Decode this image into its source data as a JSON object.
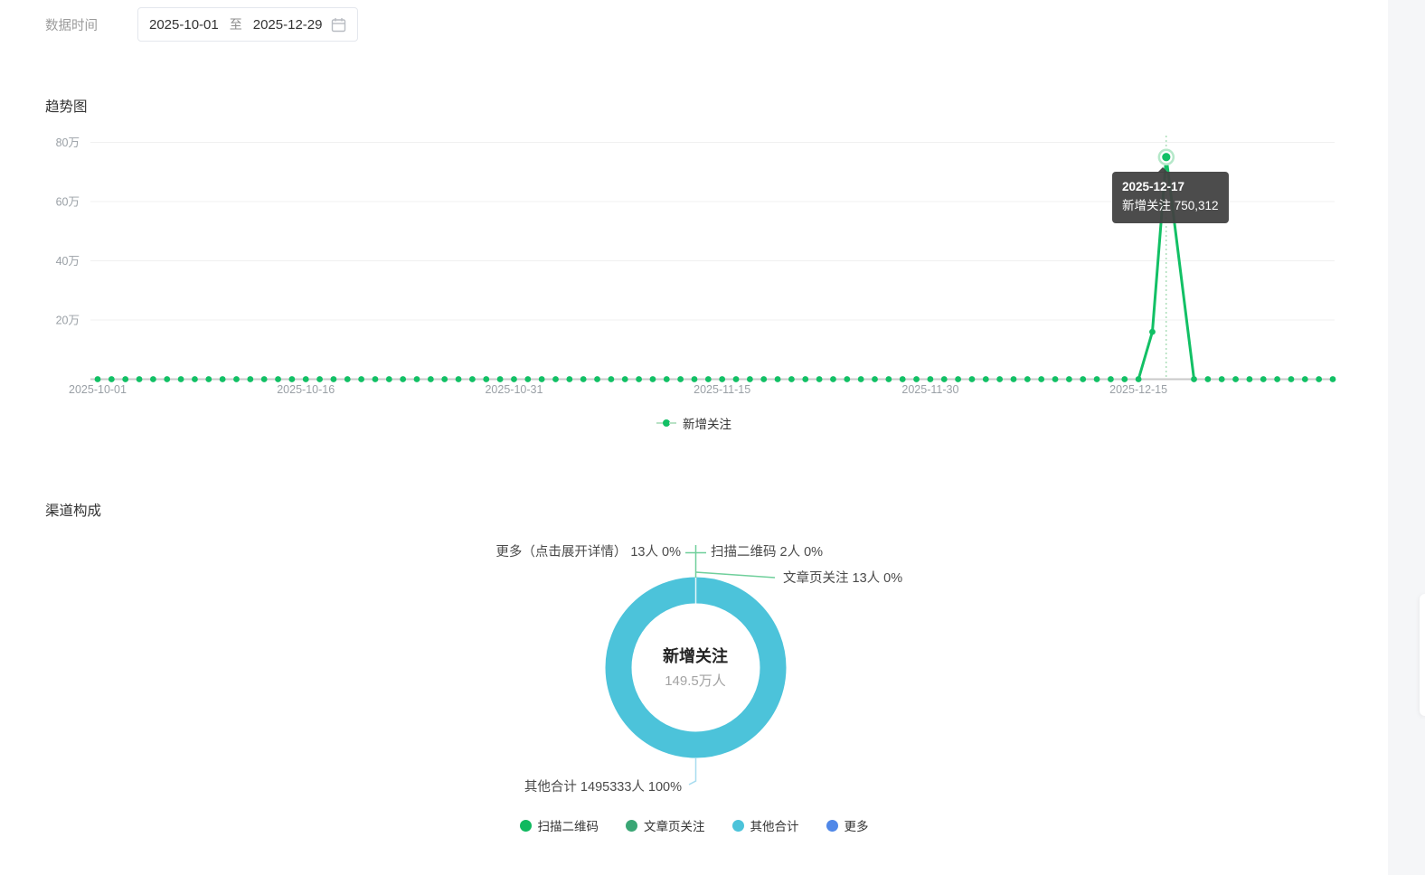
{
  "filter": {
    "label": "数据时间",
    "start_date": "2025-10-01",
    "separator": "至",
    "end_date": "2025-12-29"
  },
  "trend": {
    "title": "趋势图",
    "legend_label": "新增关注",
    "tooltip": {
      "date": "2025-12-17",
      "text": "新增关注 750,312"
    }
  },
  "channel": {
    "title": "渠道构成",
    "center_title": "新增关注",
    "center_value": "149.5万人",
    "callouts": {
      "more": "更多（点击展开详情） 13人 0%",
      "qr": "扫描二维码 2人 0%",
      "article": "文章页关注 13人 0%",
      "other": "其他合计 1495333人 100%"
    }
  },
  "colors": {
    "trend_line": "#12c065",
    "highlight_ring": "#b5e8c9",
    "pointer_line": "#86cf9a",
    "axis_line": "#c9c9c9",
    "grid_line": "#f0f0f0",
    "axis_text": "#9aa0a6",
    "donut_ring": "#4cc3da",
    "leader_teal": "#6fcf9b",
    "leader_cyan": "#a7dcef",
    "tooltip_bg": "#424242"
  },
  "chart_data": [
    {
      "type": "line",
      "title": "趋势图",
      "series": [
        {
          "name": "新增关注"
        }
      ],
      "x_start": "2025-10-01",
      "x_end": "2025-12-29",
      "x_frequency": "daily",
      "default_value": 0,
      "values_by_date": {
        "2025-12-16": 160000,
        "2025-12-17": 750312,
        "2025-12-18": null
      },
      "peak": {
        "date": "2025-12-17",
        "value": 750312,
        "label": "750,312"
      },
      "ylim": [
        0,
        800000
      ],
      "y_ticks": [
        {
          "label": "20万",
          "value": 200000
        },
        {
          "label": "40万",
          "value": 400000
        },
        {
          "label": "60万",
          "value": 600000
        },
        {
          "label": "80万",
          "value": 800000
        }
      ],
      "x_tick_labels": [
        "2025-10-01",
        "2025-10-16",
        "2025-10-31",
        "2025-11-15",
        "2025-11-30",
        "2025-12-15"
      ],
      "x_tick_every": 15,
      "grid": true,
      "legend_position": "bottom"
    },
    {
      "type": "pie",
      "donut": true,
      "title": "渠道构成",
      "center": {
        "title": "新增关注",
        "value": "149.5万人"
      },
      "slices": [
        {
          "label": "扫描二维码",
          "value": 2,
          "unit": "人",
          "percent": "0%",
          "color": "#10b95f"
        },
        {
          "label": "文章页关注",
          "value": 13,
          "unit": "人",
          "percent": "0%",
          "color": "#3aa675"
        },
        {
          "label": "其他合计",
          "value": 1495333,
          "unit": "人",
          "percent": "100%",
          "color": "#4cc3da"
        },
        {
          "label": "更多",
          "value": 13,
          "unit": "人",
          "percent": "0%",
          "color": "#5088e8"
        }
      ],
      "legend_position": "bottom"
    }
  ]
}
